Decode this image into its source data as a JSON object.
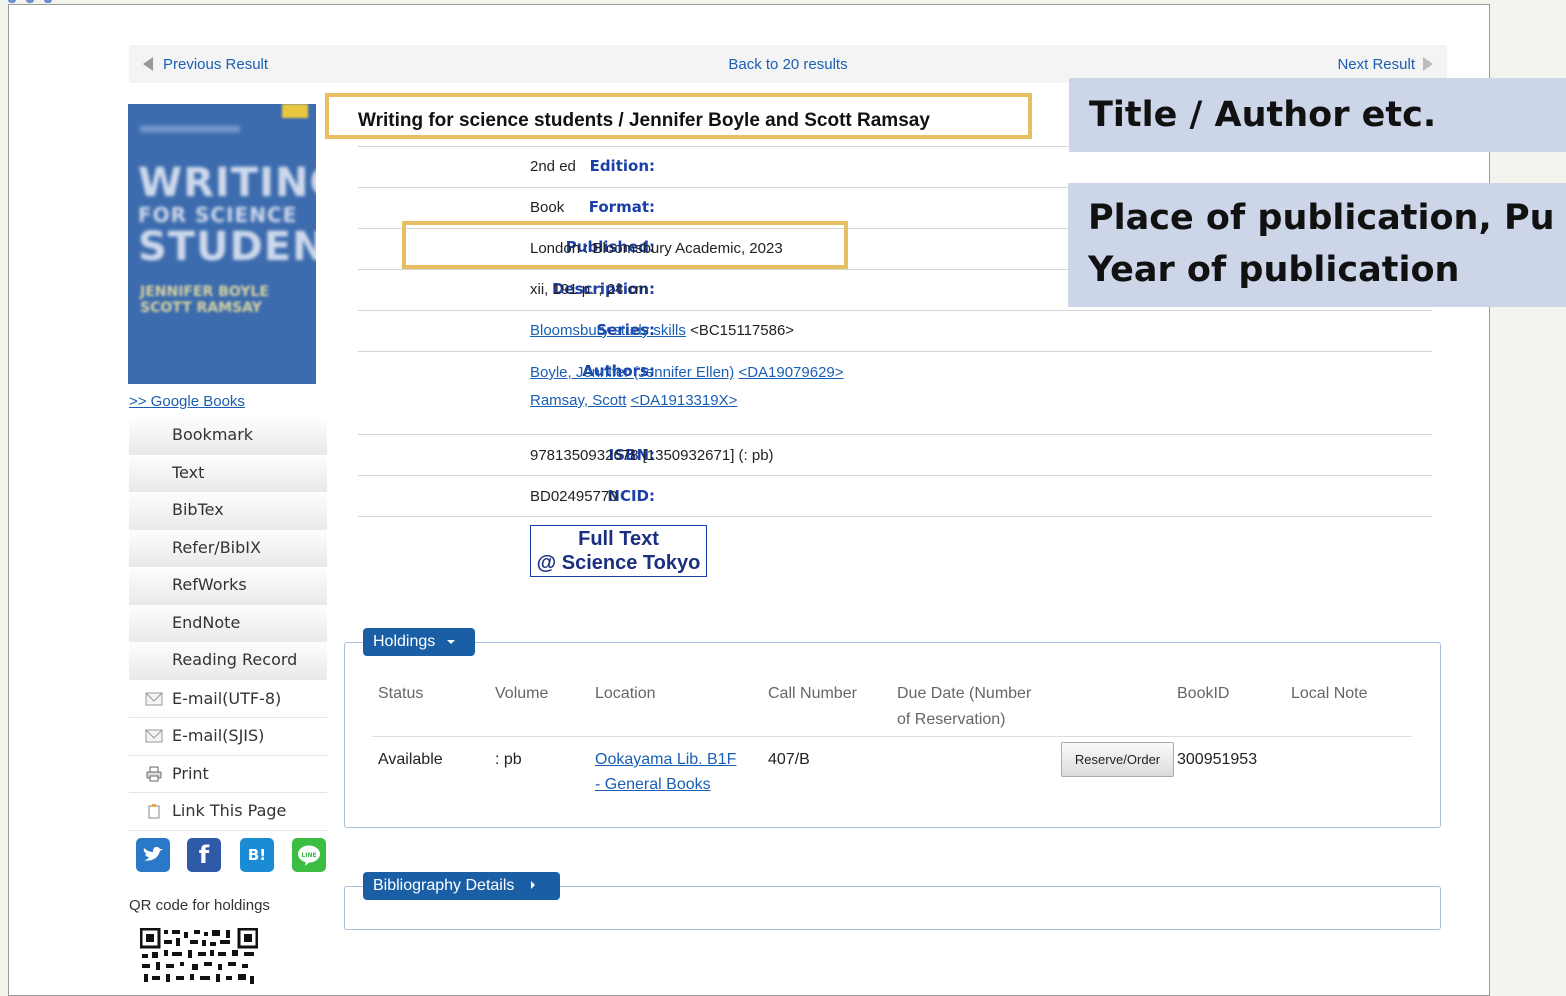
{
  "nav": {
    "prev": "Previous Result",
    "back": "Back to 20 results",
    "next": "Next Result"
  },
  "cover": {
    "line1": "WRITING",
    "line2": "FOR SCIENCE",
    "line3": "STUDENTS",
    "author1": "JENNIFER BOYLE",
    "author2": "SCOTT RAMSAY"
  },
  "google_books": ">> Google Books",
  "side_menu": {
    "export": [
      "Bookmark",
      "Text",
      "BibTex",
      "Refer/BibIX",
      "RefWorks",
      "EndNote",
      "Reading Record"
    ],
    "email_utf8": "E-mail(UTF-8)",
    "email_sjis": "E-mail(SJIS)",
    "print": "Print",
    "link": "Link This Page"
  },
  "social": {
    "twitter": "twitter-icon",
    "facebook": "f",
    "hatena": "B!",
    "line": "LINE"
  },
  "qr_label": "QR code for holdings",
  "record": {
    "title": "Writing for science students / Jennifer Boyle and Scott Ramsay",
    "edition_label": "Edition:",
    "edition": "2nd ed",
    "format_label": "Format:",
    "format": "Book",
    "published_label": "Published:",
    "published": "London : Bloomsbury Academic, 2023",
    "description_label": "Description:",
    "description": "xii, 191 p. ; 24 cm",
    "series_label": "Series:",
    "series_link": "Bloomsbury study skills",
    "series_id": "<BC15117586>",
    "authors_label": "Authors:",
    "author1_link": "Boyle, Jennifer (Jennifer Ellen)",
    "author1_id": "<DA19079629>",
    "author2_link": "Ramsay, Scott",
    "author2_id": "<DA1913319X>",
    "isbn_label": "ISBN:",
    "isbn": "9781350932678 [1350932671] (: pb)",
    "ncid_label": "NCID:",
    "ncid": "BD02495770",
    "fulltext_line1": "Full Text",
    "fulltext_line2": "@ Science Tokyo"
  },
  "annotations": {
    "title_author": "Title / Author etc.",
    "place_line1": "Place of publication, Pu",
    "place_line2": "Year of publication"
  },
  "holdings": {
    "tab": "Holdings",
    "headers": [
      "Status",
      "Volume",
      "Location",
      "Call Number",
      "Due Date (Number",
      "of Reservation)",
      "BookID",
      "Local Note"
    ],
    "row": {
      "status": "Available",
      "volume": ": pb",
      "location_line1": "Ookayama Lib. B1F",
      "location_line2": "- General Books",
      "call_number": "407/B",
      "reserve_button": "Reserve/Order",
      "book_id": "300951953"
    }
  },
  "bibliography_tab": "Bibliography Details",
  "colors": {
    "link": "#1a5fb4",
    "label": "#1b3fa8",
    "highlight": "#e6bf62",
    "overlay": "#cdd5e8",
    "tab": "#1a5fa6"
  }
}
